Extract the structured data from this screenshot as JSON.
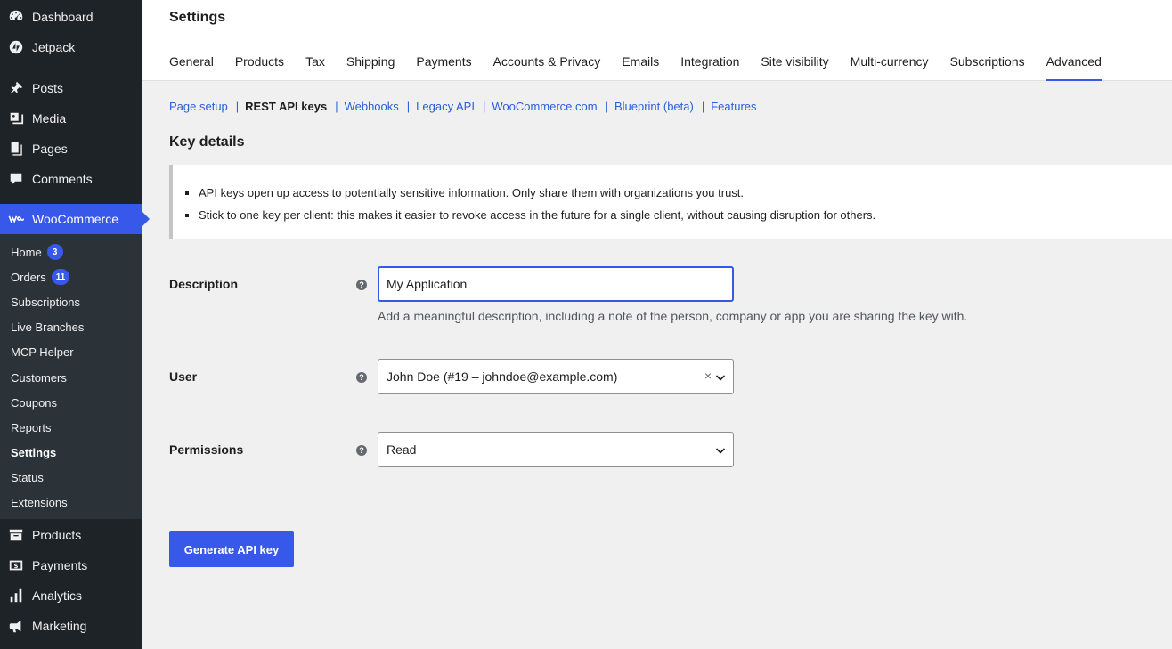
{
  "sidebar": {
    "top_items": [
      {
        "label": "Dashboard",
        "icon": "dashboard-icon"
      },
      {
        "label": "Jetpack",
        "icon": "jetpack-icon"
      }
    ],
    "mid_items": [
      {
        "label": "Posts",
        "icon": "pin-icon"
      },
      {
        "label": "Media",
        "icon": "media-icon"
      },
      {
        "label": "Pages",
        "icon": "pages-icon"
      },
      {
        "label": "Comments",
        "icon": "comment-icon"
      }
    ],
    "woocommerce": {
      "label": "WooCommerce",
      "icon": "woocommerce-icon"
    },
    "submenu": [
      {
        "label": "Home",
        "badge": "3"
      },
      {
        "label": "Orders",
        "badge": "11"
      },
      {
        "label": "Subscriptions"
      },
      {
        "label": "Live Branches"
      },
      {
        "label": "MCP Helper"
      },
      {
        "label": "Customers"
      },
      {
        "label": "Coupons"
      },
      {
        "label": "Reports"
      },
      {
        "label": "Settings"
      },
      {
        "label": "Status"
      },
      {
        "label": "Extensions"
      }
    ],
    "bottom_items": [
      {
        "label": "Products",
        "icon": "archive-icon"
      },
      {
        "label": "Payments",
        "icon": "payments-icon"
      },
      {
        "label": "Analytics",
        "icon": "analytics-icon"
      },
      {
        "label": "Marketing",
        "icon": "megaphone-icon"
      }
    ]
  },
  "header": {
    "title": "Settings",
    "tabs": [
      "General",
      "Products",
      "Tax",
      "Shipping",
      "Payments",
      "Accounts & Privacy",
      "Emails",
      "Integration",
      "Site visibility",
      "Multi-currency",
      "Subscriptions",
      "Advanced"
    ],
    "active_tab": "Advanced"
  },
  "subnav": {
    "items": [
      "Page setup",
      "REST API keys",
      "Webhooks",
      "Legacy API",
      "WooCommerce.com",
      "Blueprint (beta)",
      "Features"
    ],
    "current": "REST API keys",
    "separator": "|"
  },
  "section_title": "Key details",
  "notice": {
    "items": [
      "API keys open up access to potentially sensitive information. Only share them with organizations you trust.",
      "Stick to one key per client: this makes it easier to revoke access in the future for a single client, without causing disruption for others."
    ]
  },
  "form": {
    "description": {
      "label": "Description",
      "value": "My Application",
      "help": "Add a meaningful description, including a note of the person, company or app you are sharing the key with."
    },
    "user": {
      "label": "User",
      "value": "John Doe (#19 – johndoe@example.com)",
      "clear": "×"
    },
    "permissions": {
      "label": "Permissions",
      "value": "Read"
    },
    "help_glyph": "?"
  },
  "submit_label": "Generate API key",
  "colors": {
    "accent": "#3858e9",
    "sidebar_bg": "#1d2327",
    "submenu_bg": "#2c3338",
    "link": "#2c5ed6"
  }
}
